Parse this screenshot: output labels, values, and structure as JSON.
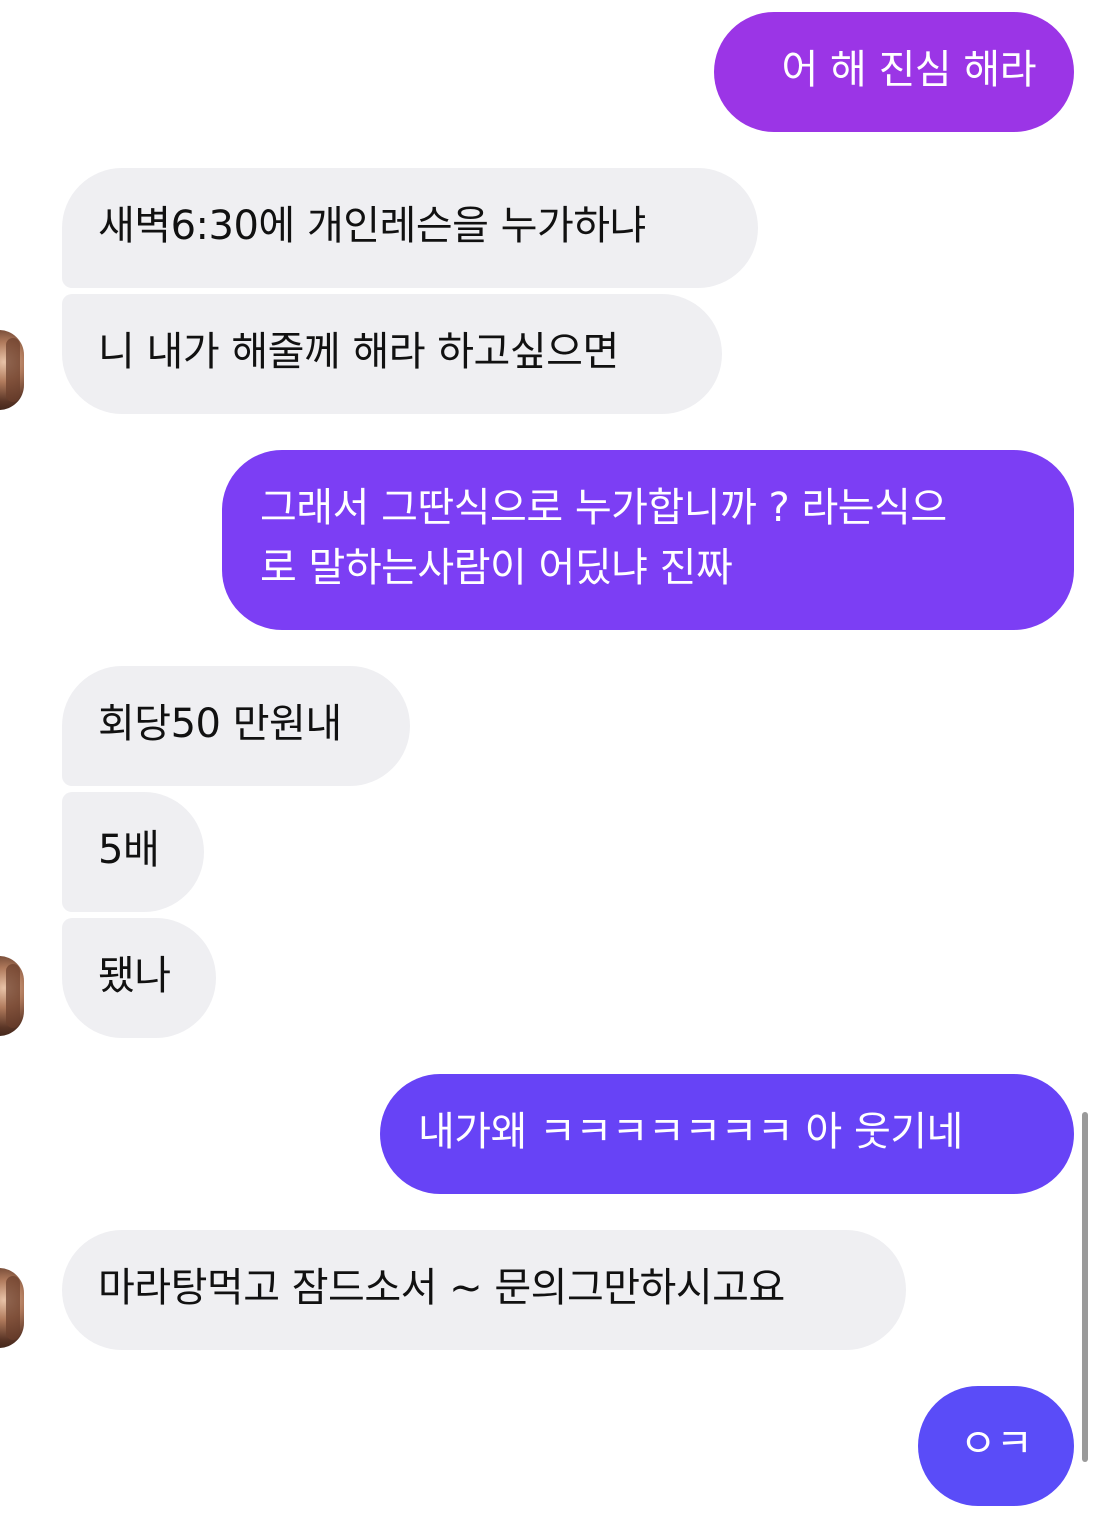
{
  "messages": [
    {
      "side": "sent",
      "text": "어 해 진심 해라"
    },
    {
      "side": "received",
      "text": "새벽6:30에 개인레슨을 누가하냐"
    },
    {
      "side": "received",
      "text": "니 내가 해줄께 해라 하고싶으면"
    },
    {
      "side": "sent",
      "text": "그래서 그딴식으로 누가합니까 ? 라는식으\n로 말하는사람이 어딨냐 진짜"
    },
    {
      "side": "received",
      "text": "회당50 만원내"
    },
    {
      "side": "received",
      "text": "5배"
    },
    {
      "side": "received",
      "text": "됐나"
    },
    {
      "side": "sent",
      "text": "내가왜 ㅋㅋㅋㅋㅋㅋㅋ 아 웃기네"
    },
    {
      "side": "received",
      "text": "마라탕먹고 잠드소서 ~ 문의그만하시고요"
    },
    {
      "side": "sent",
      "text": "ㅇㅋ"
    }
  ],
  "colors": {
    "sent_top": "#9a36e8",
    "sent_mid": "#7b3ff4",
    "sent_bottom": "#5b4cf8",
    "received_bg": "#efeff2",
    "received_text": "#111111"
  },
  "icons": {
    "avatar": "profile-avatar-icon",
    "scrollbar": "scrollbar"
  }
}
